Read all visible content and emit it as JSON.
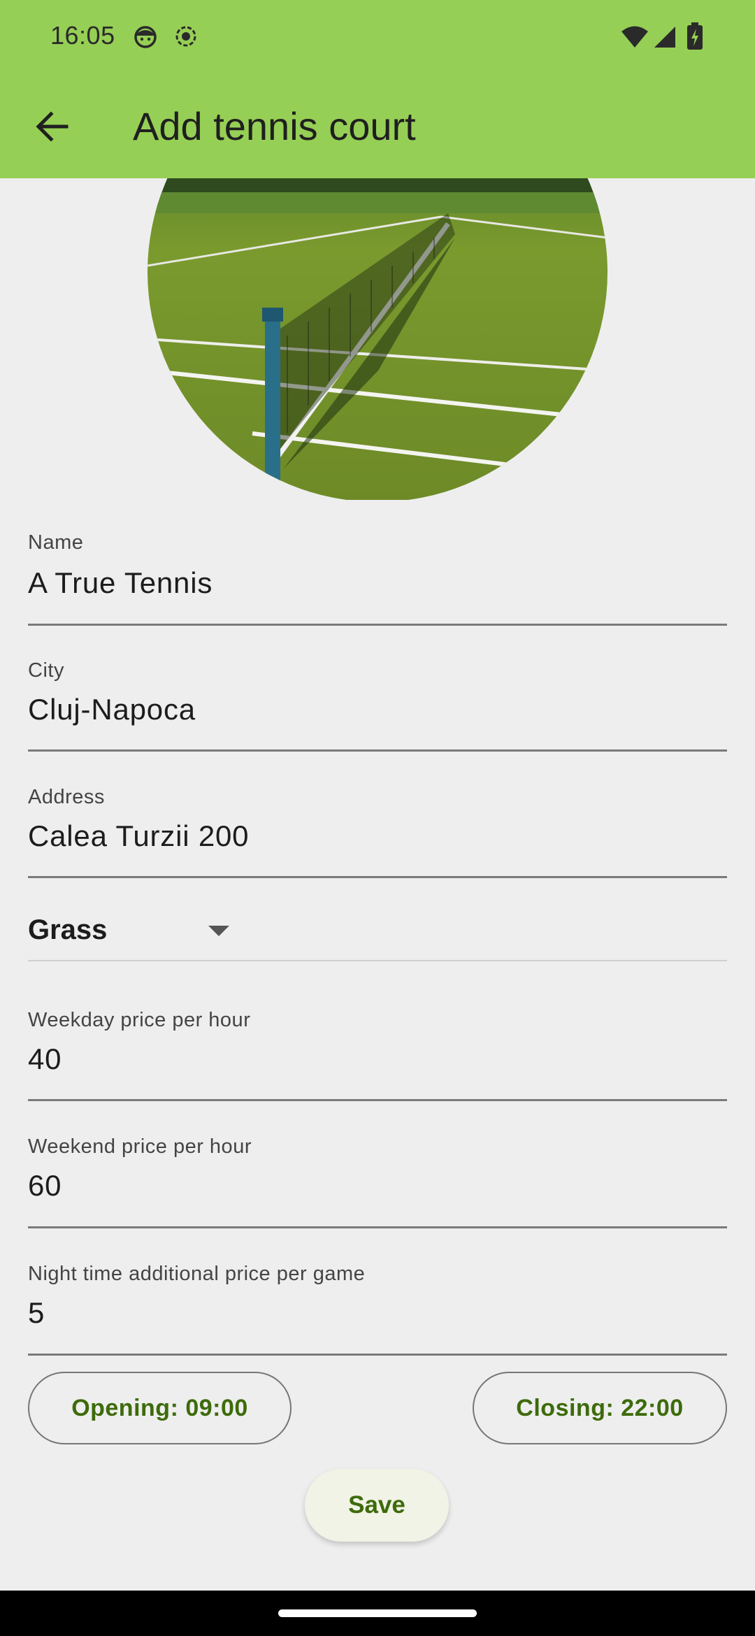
{
  "status_bar": {
    "time": "16:05",
    "left_icons": [
      "android-face-icon",
      "record-icon"
    ],
    "right_icons": [
      "wifi-icon",
      "signal-icon",
      "battery-charging-icon"
    ]
  },
  "app_bar": {
    "back_icon": "arrow-left-icon",
    "title": "Add tennis court",
    "color": "#96cf55"
  },
  "court_image": {
    "subject": "tennis court with net (grass)"
  },
  "form": {
    "name": {
      "label": "Name",
      "value": "A True Tennis"
    },
    "city": {
      "label": "City",
      "value": "Cluj-Napoca"
    },
    "address": {
      "label": "Address",
      "value": "Calea Turzii 200"
    },
    "surface": {
      "selected": "Grass"
    },
    "weekday_price": {
      "label": "Weekday price per hour",
      "value": "40"
    },
    "weekend_price": {
      "label": "Weekend price per hour",
      "value": "60"
    },
    "night_price": {
      "label": "Night time additional price per game",
      "value": "5"
    }
  },
  "buttons": {
    "opening": "Opening: 09:00",
    "closing": "Closing: 22:00",
    "save": "Save",
    "accent_color": "#3d6b0b"
  }
}
